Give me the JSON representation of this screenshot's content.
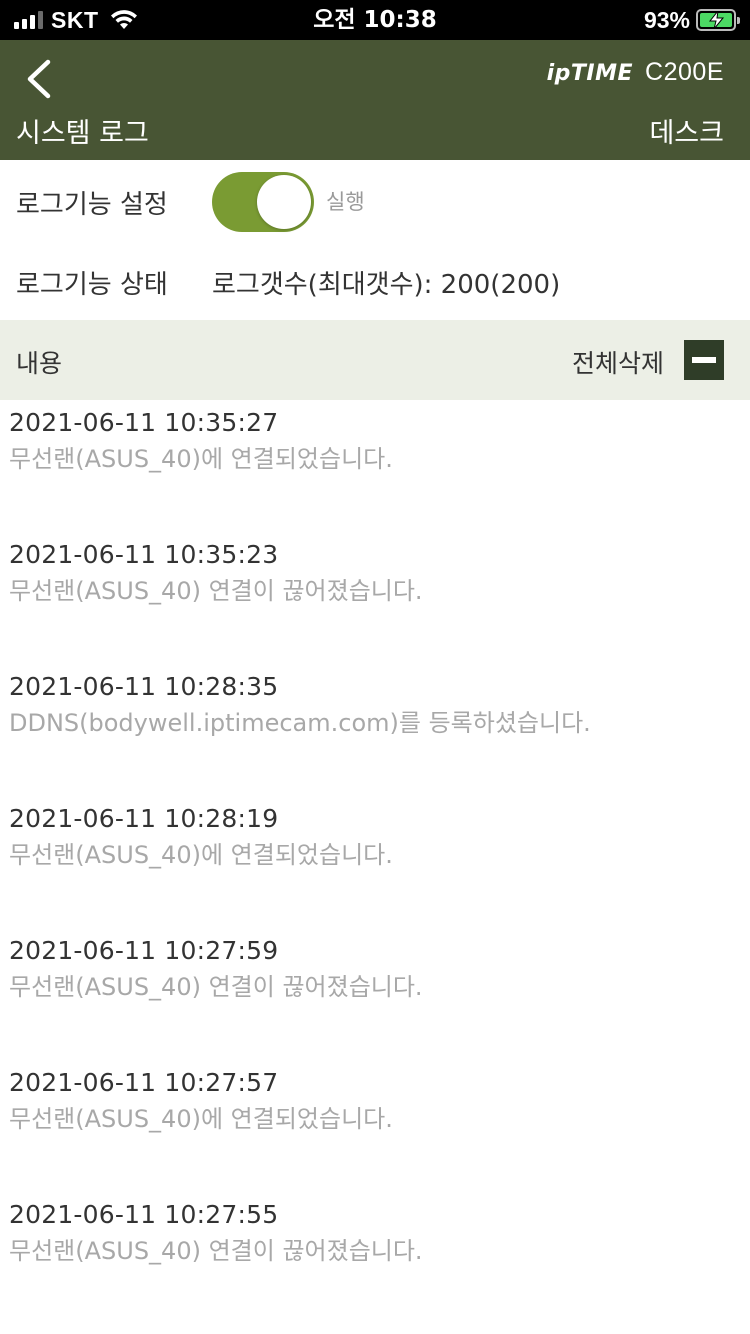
{
  "status_bar": {
    "carrier": "SKT",
    "time": "오전 10:38",
    "battery_percent": "93%"
  },
  "header": {
    "brand": "ipTIME",
    "model": "C200E",
    "title": "시스템 로그",
    "device_name": "데스크"
  },
  "settings": {
    "log_setting_label": "로그기능 설정",
    "toggle_on": true,
    "toggle_state_label": "실행",
    "log_status_label": "로그기능 상태",
    "log_status_value": "로그갯수(최대갯수): 200(200)"
  },
  "list_header": {
    "title": "내용",
    "delete_all_label": "전체삭제"
  },
  "logs": [
    {
      "time": "2021-06-11 10:35:27",
      "message": "무선랜(ASUS_40)에  연결되었습니다."
    },
    {
      "time": "2021-06-11 10:35:23",
      "message": "무선랜(ASUS_40) 연결이 끊어졌습니다."
    },
    {
      "time": "2021-06-11 10:28:35",
      "message": "DDNS(bodywell.iptimecam.com)를 등록하셨습니다."
    },
    {
      "time": "2021-06-11 10:28:19",
      "message": "무선랜(ASUS_40)에  연결되었습니다."
    },
    {
      "time": "2021-06-11 10:27:59",
      "message": "무선랜(ASUS_40) 연결이 끊어졌습니다."
    },
    {
      "time": "2021-06-11 10:27:57",
      "message": "무선랜(ASUS_40)에  연결되었습니다."
    },
    {
      "time": "2021-06-11 10:27:55",
      "message": "무선랜(ASUS_40) 연결이 끊어졌습니다."
    }
  ],
  "colors": {
    "header_bg": "#485534",
    "toggle_on": "#7a9b33",
    "list_header_bg": "#ecefe6",
    "delete_button": "#2f3d28"
  }
}
